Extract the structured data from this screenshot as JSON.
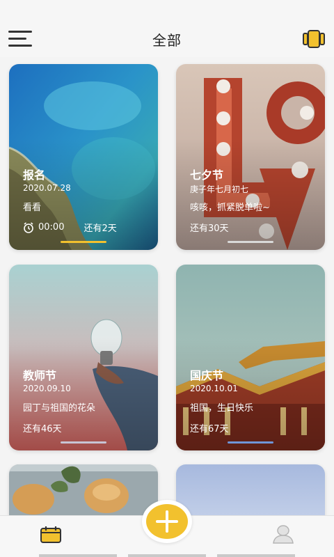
{
  "header": {
    "title": "全部",
    "menu_icon": "menu-icon",
    "view_icon": "card-view-icon"
  },
  "cards": [
    {
      "name": "报名",
      "date": "2020.07.28",
      "note": "看看",
      "time": "00:00",
      "countdown": "还有2天",
      "theme": "ocean",
      "indicator_color": "#f2c12e"
    },
    {
      "name": "七夕节",
      "date": "庚子年七月初七",
      "note": "咳咳，抓紧脱单啦~",
      "countdown": "还有30天",
      "theme": "love",
      "indicator_color": "#d9d9d9"
    },
    {
      "name": "教师节",
      "date": "2020.09.10",
      "note": "园丁与祖国的花朵",
      "countdown": "还有46天",
      "theme": "bulb",
      "indicator_color": "#c8c4d4"
    },
    {
      "name": "国庆节",
      "date": "2020.10.01",
      "note": "祖国，生日快乐",
      "countdown": "还有67天",
      "theme": "palace",
      "indicator_color": "#6f95d8"
    },
    {
      "theme": "bread"
    },
    {
      "theme": "sky"
    }
  ],
  "bottom_nav": {
    "calendar_icon": "calendar-icon",
    "add_icon": "plus-icon",
    "profile_icon": "user-icon"
  },
  "colors": {
    "accent": "#f2c12e",
    "background": "#f4f4f4"
  }
}
